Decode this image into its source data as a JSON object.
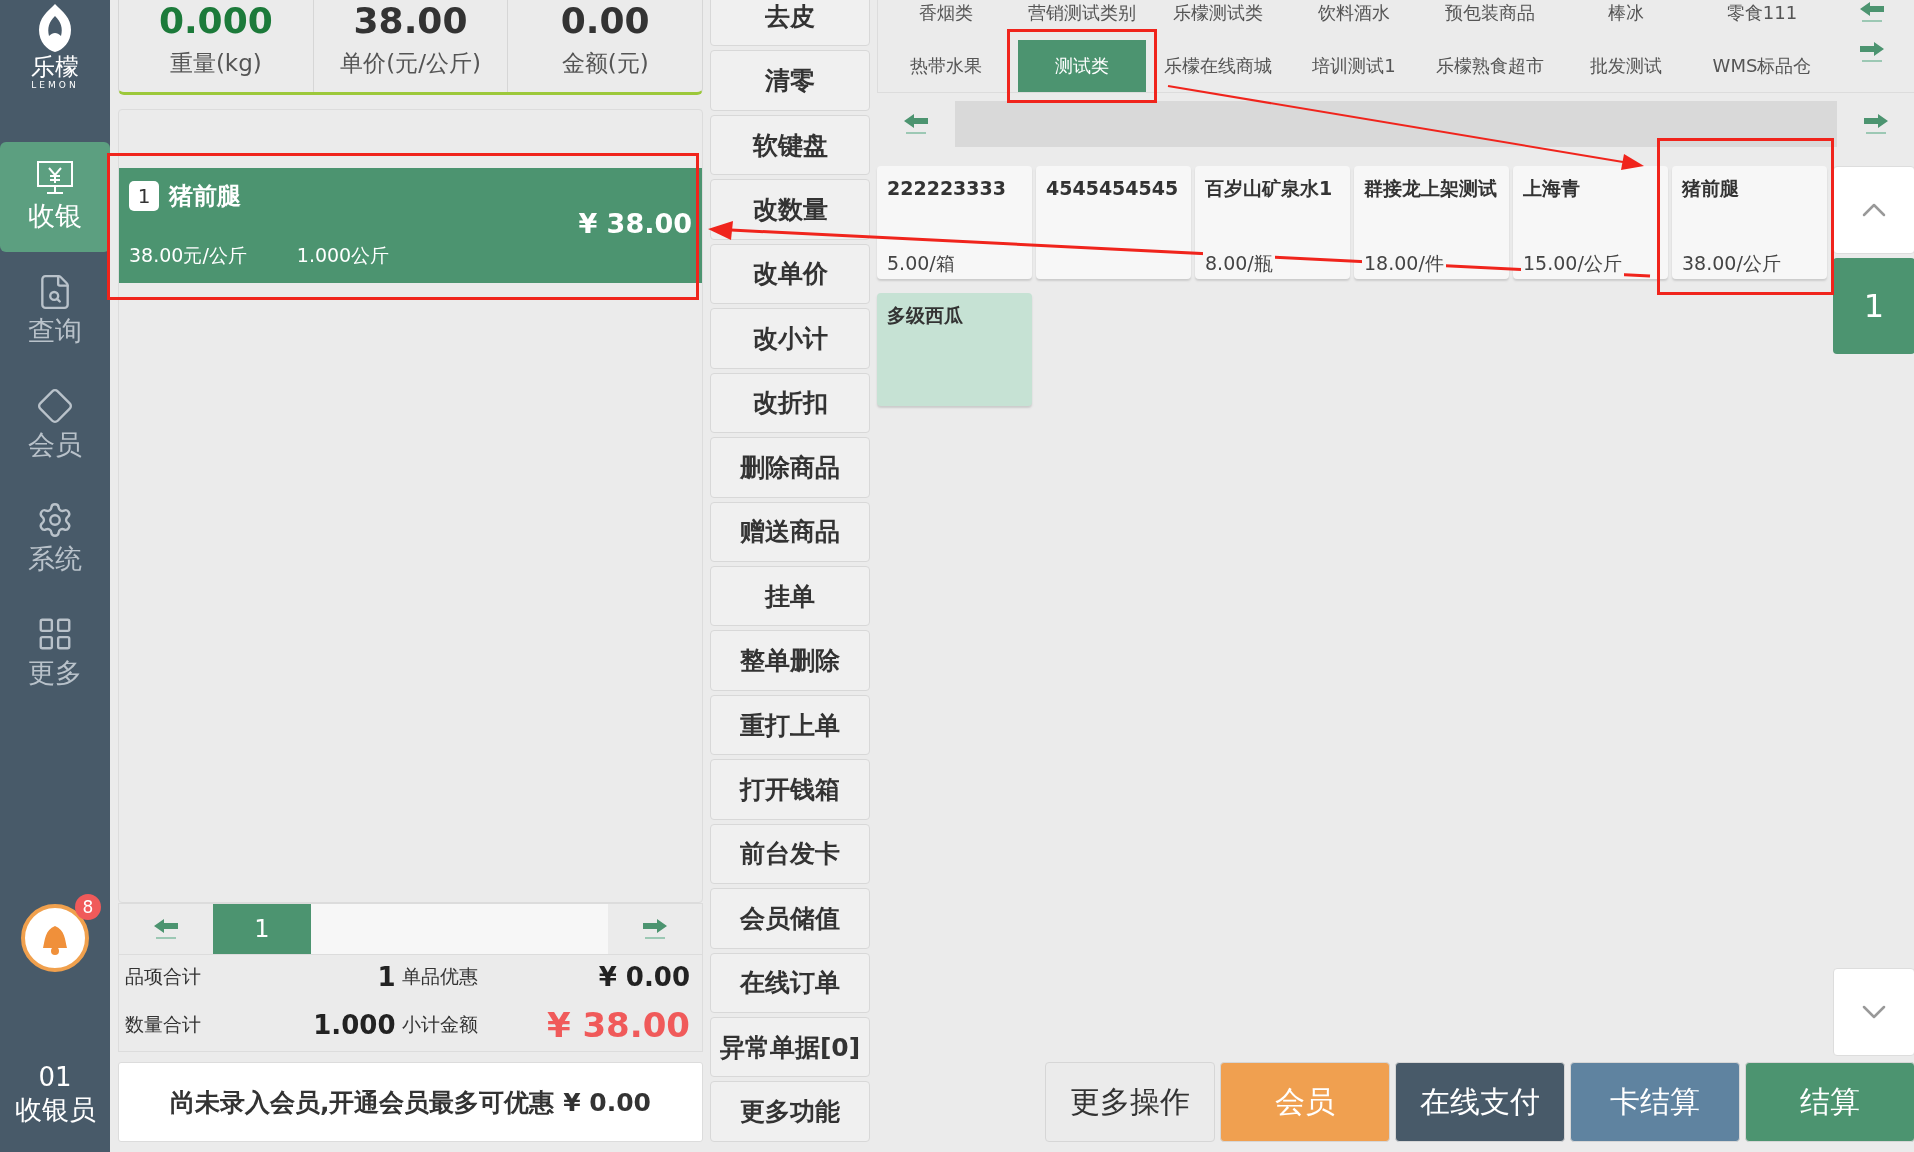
{
  "sidebar": {
    "logo": {
      "name": "乐檬",
      "tagline": "LEMON"
    },
    "items": [
      {
        "label": "收银",
        "kind": "cashier",
        "selected": true
      },
      {
        "label": "查询",
        "kind": "query",
        "selected": false
      },
      {
        "label": "会员",
        "kind": "member",
        "selected": false
      },
      {
        "label": "系统",
        "kind": "system",
        "selected": false
      },
      {
        "label": "更多",
        "kind": "more",
        "selected": false
      }
    ],
    "notifications": {
      "count": "8"
    },
    "operator": {
      "id": "01",
      "role": "收银员"
    }
  },
  "scale": [
    {
      "value": "0.000",
      "label": "重量(kg)",
      "kind": "weight"
    },
    {
      "value": "38.00",
      "label": "单价(元/公斤)",
      "kind": "price"
    },
    {
      "value": "0.00",
      "label": "金额(元)",
      "kind": "amount"
    }
  ],
  "ticket": {
    "items": [
      {
        "index": "1",
        "name": "猪前腿",
        "amount": "¥ 38.00",
        "unit_price": "38.00元/公斤",
        "quantity": "1.000公斤",
        "selected": true
      }
    ]
  },
  "pager": {
    "pages": [
      {
        "label": "1",
        "selected": true
      }
    ]
  },
  "totals": {
    "item_count_label": "品项合计",
    "item_count": "1",
    "discount_label": "单品优惠",
    "discount": "¥ 0.00",
    "quantity_label": "数量合计",
    "quantity": "1.000",
    "subtotal_label": "小计金额",
    "subtotal": "¥ 38.00"
  },
  "member_bar": "尚未录入会员,开通会员最多可优惠 ¥ 0.00",
  "function_buttons": [
    "去皮",
    "清零",
    "软键盘",
    "改数量",
    "改单价",
    "改小计",
    "改折扣",
    "删除商品",
    "赠送商品",
    "挂单",
    "整单删除",
    "重打上单",
    "打开钱箱",
    "前台发卡",
    "会员储值",
    "在线订单",
    "异常单据[0]",
    "更多功能"
  ],
  "categories": [
    {
      "label": "香烟类",
      "selected": false
    },
    {
      "label": "营销测试类别",
      "selected": false
    },
    {
      "label": "乐檬测试类",
      "selected": false
    },
    {
      "label": "饮料酒水",
      "selected": false
    },
    {
      "label": "预包装商品",
      "selected": false
    },
    {
      "label": "棒冰",
      "selected": false
    },
    {
      "label": "零食111",
      "selected": false
    },
    {
      "label": "热带水果",
      "selected": false
    },
    {
      "label": "测试类",
      "selected": true
    },
    {
      "label": "乐檬在线商城",
      "selected": false
    },
    {
      "label": "培训测试1",
      "selected": false
    },
    {
      "label": "乐檬熟食超市",
      "selected": false
    },
    {
      "label": "批发测试",
      "selected": false
    },
    {
      "label": "WMS标品仓",
      "selected": false
    }
  ],
  "products": [
    {
      "name": "222223333",
      "price": "5.00/箱",
      "color": "#f7f7f7"
    },
    {
      "name": "4545454545",
      "color": "#f7f7f7"
    },
    {
      "name": "百岁山矿泉水1",
      "price": "8.00/瓶",
      "color": "#f7f7f7"
    },
    {
      "name": "群接龙上架测试",
      "price": "18.00/件",
      "color": "#f7f7f7"
    },
    {
      "name": "上海青",
      "price": "15.00/公斤",
      "color": "#f7f7f7"
    },
    {
      "name": "猪前腿",
      "price": "38.00/公斤",
      "color": "#f7f7f7"
    },
    {
      "name": "多级西瓜",
      "color": "#c6e2d4"
    }
  ],
  "product_pager": {
    "page": "1"
  },
  "payment_buttons": [
    {
      "label": "更多操作",
      "kind": "more"
    },
    {
      "label": "会员",
      "kind": "member"
    },
    {
      "label": "在线支付",
      "kind": "online"
    },
    {
      "label": "卡结算",
      "kind": "card"
    },
    {
      "label": "结算",
      "kind": "checkout"
    }
  ]
}
